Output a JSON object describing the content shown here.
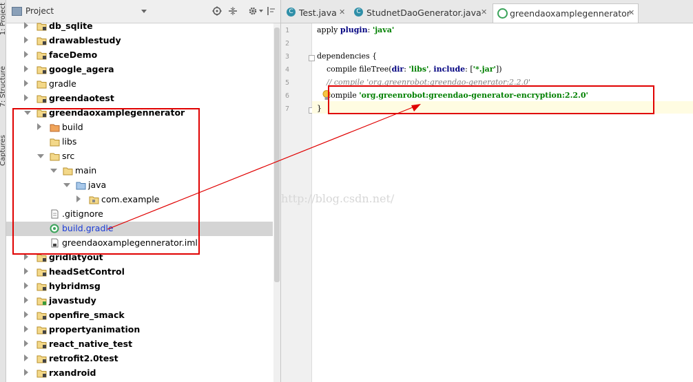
{
  "side_tabs": [
    "1: Project",
    "7: Structure",
    "Captures"
  ],
  "project_panel": {
    "title": "Project",
    "tree": [
      {
        "label": "db_sqlite",
        "depth": 0,
        "arrow": "collapsed",
        "icon": "module-folder",
        "bold": true
      },
      {
        "label": "drawablestudy",
        "depth": 0,
        "arrow": "collapsed",
        "icon": "module-folder",
        "bold": true
      },
      {
        "label": "faceDemo",
        "depth": 0,
        "arrow": "collapsed",
        "icon": "module-folder",
        "bold": true
      },
      {
        "label": "google_agera",
        "depth": 0,
        "arrow": "collapsed",
        "icon": "module-folder",
        "bold": true
      },
      {
        "label": "gradle",
        "depth": 0,
        "arrow": "collapsed",
        "icon": "folder",
        "bold": false
      },
      {
        "label": "greendaotest",
        "depth": 0,
        "arrow": "collapsed",
        "icon": "module-folder",
        "bold": true
      },
      {
        "label": "greendaoxamplegennerator",
        "depth": 0,
        "arrow": "expanded",
        "icon": "module-folder",
        "bold": true
      },
      {
        "label": "build",
        "depth": 1,
        "arrow": "collapsed",
        "icon": "folder-orange",
        "bold": false
      },
      {
        "label": "libs",
        "depth": 1,
        "arrow": "none",
        "icon": "folder",
        "bold": false
      },
      {
        "label": "src",
        "depth": 1,
        "arrow": "expanded",
        "icon": "folder",
        "bold": false
      },
      {
        "label": "main",
        "depth": 2,
        "arrow": "expanded",
        "icon": "folder",
        "bold": false
      },
      {
        "label": "java",
        "depth": 3,
        "arrow": "expanded",
        "icon": "folder-blue",
        "bold": false
      },
      {
        "label": "com.example",
        "depth": 4,
        "arrow": "collapsed",
        "icon": "package",
        "bold": false
      },
      {
        "label": ".gitignore",
        "depth": 1,
        "arrow": "none",
        "icon": "file",
        "bold": false
      },
      {
        "label": "build.gradle",
        "depth": 1,
        "arrow": "none",
        "icon": "gradle",
        "bold": false,
        "selected": true,
        "link": true
      },
      {
        "label": "greendaoxamplegennerator.iml",
        "depth": 1,
        "arrow": "none",
        "icon": "iml",
        "bold": false
      },
      {
        "label": "gridlatyout",
        "depth": 0,
        "arrow": "collapsed",
        "icon": "module-folder",
        "bold": true
      },
      {
        "label": "headSetControl",
        "depth": 0,
        "arrow": "collapsed",
        "icon": "module-folder",
        "bold": true
      },
      {
        "label": "hybridmsg",
        "depth": 0,
        "arrow": "collapsed",
        "icon": "module-folder",
        "bold": true
      },
      {
        "label": "javastudy",
        "depth": 0,
        "arrow": "collapsed",
        "icon": "module-folder-green",
        "bold": true
      },
      {
        "label": "openfire_smack",
        "depth": 0,
        "arrow": "collapsed",
        "icon": "module-folder",
        "bold": true
      },
      {
        "label": "propertyanimation",
        "depth": 0,
        "arrow": "collapsed",
        "icon": "module-folder",
        "bold": true
      },
      {
        "label": "react_native_test",
        "depth": 0,
        "arrow": "collapsed",
        "icon": "module-folder",
        "bold": true
      },
      {
        "label": "retrofit2.0test",
        "depth": 0,
        "arrow": "collapsed",
        "icon": "module-folder",
        "bold": true
      },
      {
        "label": "rxandroid",
        "depth": 0,
        "arrow": "collapsed",
        "icon": "module-folder",
        "bold": true
      }
    ]
  },
  "editor": {
    "tabs": [
      {
        "label": "Test.java",
        "icon": "java-class",
        "active": false
      },
      {
        "label": "StudnetDaoGenerator.java",
        "icon": "java-class",
        "active": false
      },
      {
        "label": "greendaoxamplegennerator",
        "icon": "gradle",
        "active": true
      }
    ],
    "line_numbers": [
      "1",
      "2",
      "3",
      "4",
      "5",
      "6",
      "7"
    ],
    "code": {
      "l1": {
        "a": "apply ",
        "b": "plugin",
        "c": ": ",
        "d": "'java'"
      },
      "l3": "dependencies {",
      "l4": {
        "a": "    compile fileTree(",
        "b": "dir",
        "c": ": ",
        "d": "'libs'",
        "e": ", ",
        "f": "include",
        "g": ": [",
        "h": "'*.jar'",
        "i": "])"
      },
      "l5": "    // compile 'org.greenrobot:greendao-generator:2.2.0'",
      "l6": {
        "a": "    compile ",
        "b": "'org.greenrobot:greendao-generator-encryption:2.2.0'"
      },
      "l7": "}"
    }
  },
  "watermark": "http://blog.csdn.net/",
  "colors": {
    "annotation_red": "#e00000",
    "keyword": "#000080",
    "string": "#008000",
    "selection": "#d4d4d4"
  }
}
